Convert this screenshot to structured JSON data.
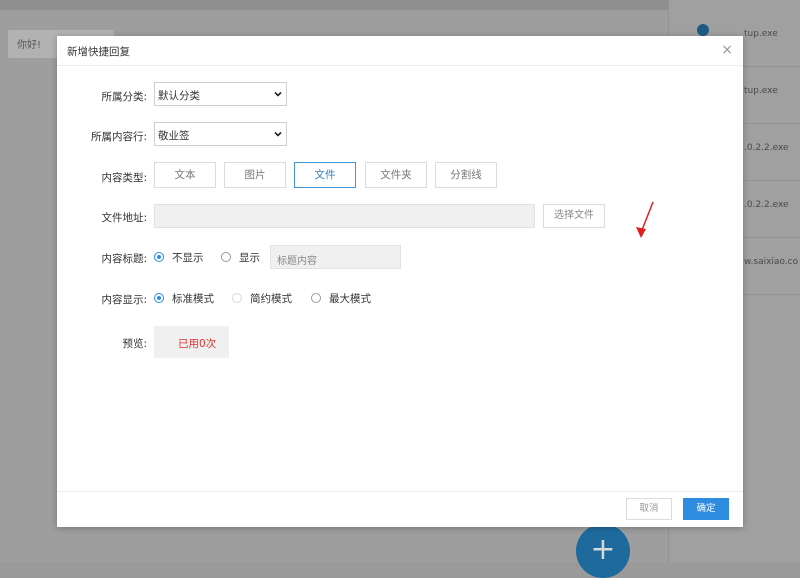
{
  "background": {
    "greeting": "你好!",
    "files": [
      "tup.exe",
      "tup.exe",
      ".0.2.2.exe",
      ".0.2.2.exe",
      "w.saixiao.co"
    ],
    "fab_label": "+"
  },
  "dialog": {
    "title": "新增快捷回复",
    "close_label": "×",
    "category": {
      "label": "所属分类:",
      "value": "默认分类"
    },
    "industry": {
      "label": "所属内容行:",
      "value": "敬业签"
    },
    "content_type": {
      "label": "内容类型:",
      "options": [
        "文本",
        "图片",
        "文件",
        "文件夹",
        "分割线"
      ],
      "selected": "文件"
    },
    "file_address": {
      "label": "文件地址:",
      "value": "",
      "button_label": "选择文件"
    },
    "content_title": {
      "label": "内容标题:",
      "options": [
        "不显示",
        "显示"
      ],
      "selected": "不显示",
      "placeholder": "标题内容"
    },
    "content_display": {
      "label": "内容显示:",
      "options": [
        "标准模式",
        "简约模式",
        "最大模式"
      ],
      "selected": "标准模式"
    },
    "preview": {
      "label": "预览:",
      "text": "已用0次"
    },
    "footer": {
      "cancel_label": "取消",
      "confirm_label": "确定"
    }
  },
  "colors": {
    "accent": "#2d8ce0",
    "danger": "#e0322d",
    "annotation_arrow": "#e02020"
  }
}
